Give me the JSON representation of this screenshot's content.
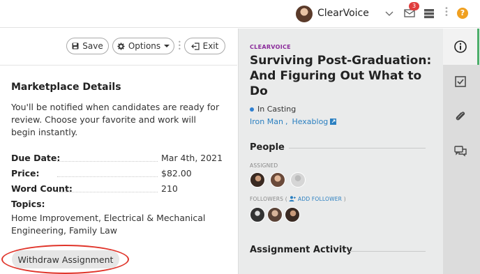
{
  "topbar": {
    "user_name": "ClearVoice",
    "mail_badge": "3",
    "help_glyph": "?",
    "icons": [
      "avatar",
      "chevron-down-icon",
      "mail-icon",
      "server-icon",
      "more-dots-icon",
      "help-icon"
    ]
  },
  "toolbar": {
    "save_label": "Save",
    "options_label": "Options",
    "exit_label": "Exit"
  },
  "marketplace": {
    "title": "Marketplace Details",
    "description": "You'll be notified when candidates are ready for review. Choose your favorite and work will begin instantly.",
    "rows": [
      {
        "label": "Due Date:",
        "value": "Mar 4th, 2021"
      },
      {
        "label": "Price:",
        "value": "$82.00"
      },
      {
        "label": "Word Count:",
        "value": "210"
      }
    ],
    "topics_label": "Topics:",
    "topics_value": "Home Improvement, Electrical & Mechanical Engineering, Family Law",
    "withdraw_label": "Withdraw Assignment"
  },
  "assignment": {
    "brand": "CLEARVOICE",
    "title": "Surviving Post-Graduation: And Figuring Out What to Do",
    "status": "In Casting",
    "link_1": "Iron Man",
    "link_sep": ",",
    "link_2": "Hexablog",
    "people_title": "People",
    "assigned_label": "ASSIGNED",
    "followers_label": "FOLLOWERS (",
    "add_follower": "ADD FOLLOWER",
    "followers_close": ")",
    "activity_title": "Assignment Activity"
  },
  "colors": {
    "accent_green": "#4cae6a",
    "brand_purple": "#8a2a9a",
    "link_blue": "#2a7fc0",
    "badge_red": "#e03c3c",
    "highlight_red": "#e0352b",
    "help_orange": "#f0a020"
  }
}
